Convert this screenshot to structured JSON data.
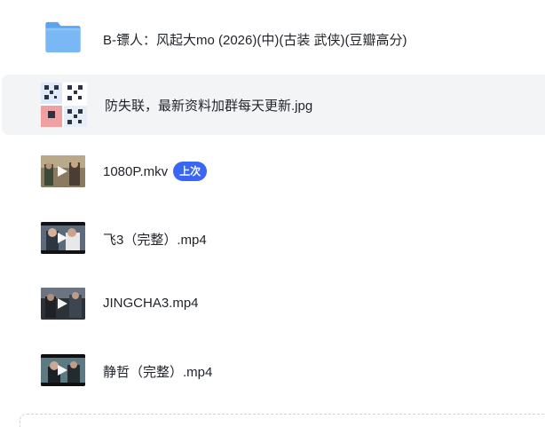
{
  "files": [
    {
      "name": "B-镖人：风起大mo (2026)(中)(古装 武侠)(豆瓣高分)",
      "type": "folder",
      "icon": "folder-icon"
    },
    {
      "name": "防失联，最新资料加群每天更新.jpg",
      "type": "image",
      "icon": "qr-image-thumbnail"
    },
    {
      "name": "1080P.mkv",
      "type": "video",
      "icon": "video-thumbnail",
      "badge": "上次"
    },
    {
      "name": "飞3（完整）.mp4",
      "type": "video",
      "icon": "video-thumbnail"
    },
    {
      "name": "JINGCHA3.mp4",
      "type": "video",
      "icon": "video-thumbnail"
    },
    {
      "name": "静哲（完整）.mp4",
      "type": "video",
      "icon": "video-thumbnail"
    }
  ],
  "colors": {
    "folder": "#7ab8f5",
    "badge": "#3b66f5",
    "hover_row": "#f3f4f6",
    "text": "#1f2329"
  }
}
